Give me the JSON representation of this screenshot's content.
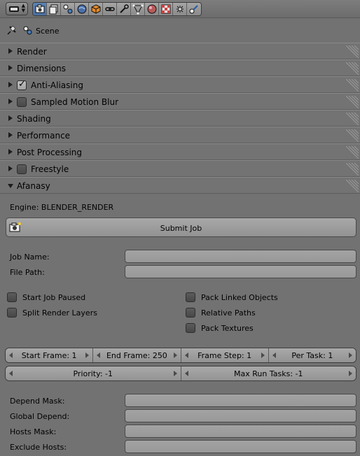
{
  "header": {
    "editor_icon": "properties-editor-icon",
    "tabs": [
      {
        "icon": "render-icon",
        "active": true
      },
      {
        "icon": "render-layers-icon",
        "active": false
      },
      {
        "icon": "scene-icon",
        "active": false
      },
      {
        "icon": "world-icon",
        "active": false
      },
      {
        "icon": "object-icon",
        "active": false
      },
      {
        "icon": "constraints-icon",
        "active": false
      },
      {
        "icon": "modifiers-icon",
        "active": false
      },
      {
        "icon": "data-icon",
        "active": false
      },
      {
        "icon": "material-icon",
        "active": false
      },
      {
        "icon": "texture-icon",
        "active": false
      },
      {
        "icon": "particles-icon",
        "active": false
      },
      {
        "icon": "physics-icon",
        "active": false
      }
    ]
  },
  "context": {
    "scene_label": "Scene"
  },
  "panels": {
    "render": "Render",
    "dimensions": "Dimensions",
    "anti_aliasing": "Anti-Aliasing",
    "sampled_motion_blur": "Sampled Motion Blur",
    "shading": "Shading",
    "performance": "Performance",
    "post_processing": "Post Processing",
    "freestyle": "Freestyle",
    "afanasy": "Afanasy"
  },
  "afanasy": {
    "engine": "Engine: BLENDER_RENDER",
    "submit_label": "Submit Job",
    "job_name_label": "Job Name:",
    "job_name_value": "",
    "file_path_label": "File Path:",
    "file_path_value": "",
    "start_paused": "Start Job Paused",
    "split_layers": "Split Render Layers",
    "pack_linked": "Pack Linked Objects",
    "relative_paths": "Relative Paths",
    "pack_textures": "Pack Textures",
    "start_frame": "Start Frame: 1",
    "end_frame": "End Frame: 250",
    "frame_step": "Frame Step: 1",
    "per_task": "Per Task: 1",
    "priority": "Priority: -1",
    "max_run_tasks": "Max Run Tasks: -1",
    "depend_mask_label": "Depend Mask:",
    "global_depend_label": "Global Depend:",
    "hosts_mask_label": "Hosts Mask:",
    "exclude_hosts_label": "Exclude Hosts:"
  },
  "colors": {
    "active_tab": "#5a84b8",
    "background": "#727272"
  }
}
